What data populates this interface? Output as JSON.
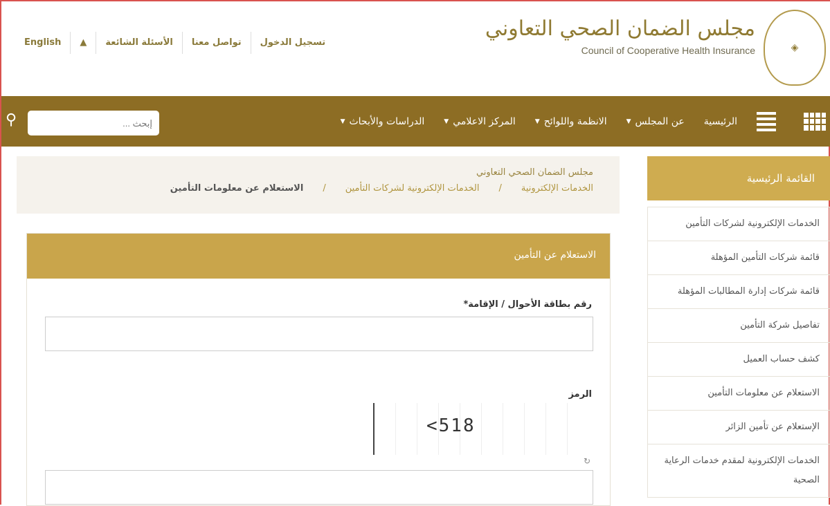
{
  "header": {
    "links": [
      "تسجيل الدخول",
      "تواصل معنا",
      "الأسئلة الشائعة"
    ],
    "sitemap_icon": "sitemap-icon",
    "language": "English",
    "logo_ar": "مجلس الضمان الصحي التعاوني",
    "logo_en": "Council of Cooperative Health Insurance"
  },
  "nav": {
    "items": [
      {
        "label": "الرئيسية",
        "dropdown": false
      },
      {
        "label": "عن المجلس",
        "dropdown": true
      },
      {
        "label": "الانظمة واللوائح",
        "dropdown": true
      },
      {
        "label": "المركز الاعلامي",
        "dropdown": true
      },
      {
        "label": "الدراسات والأبحاث",
        "dropdown": true
      }
    ],
    "search_placeholder": "إبحث ...",
    "color": "#8d6d24"
  },
  "breadcrumb": {
    "title": "مجلس الضمان الصحي التعاوني",
    "items": [
      "الخدمات الإلكترونية",
      "الخدمات الإلكترونية لشركات التأمين",
      "الاستعلام عن معلومات التأمين"
    ],
    "separator": "/"
  },
  "form": {
    "title": "الاستعلام عن التأمين",
    "id_label": "رقم بطاقة الأحوال / الإقامة*",
    "id_value": "",
    "code_label": "الرمز",
    "captcha_text": "<518",
    "code_value": ""
  },
  "sidebar": {
    "title": "القائمة الرئيسية",
    "items": [
      "الخدمات الإلكترونية لشركات التأمين",
      "قائمة شركات التأمين المؤهلة",
      "قائمة شركات إدارة المطالبات المؤهلة",
      "تفاصيل شركة التأمين",
      "كشف حساب العميل",
      "الاستعلام عن معلومات التأمين",
      "الإستعلام عن تأمين الزائر",
      "الخدمات الإلكترونية لمقدم خدمات الرعاية الصحية"
    ]
  }
}
